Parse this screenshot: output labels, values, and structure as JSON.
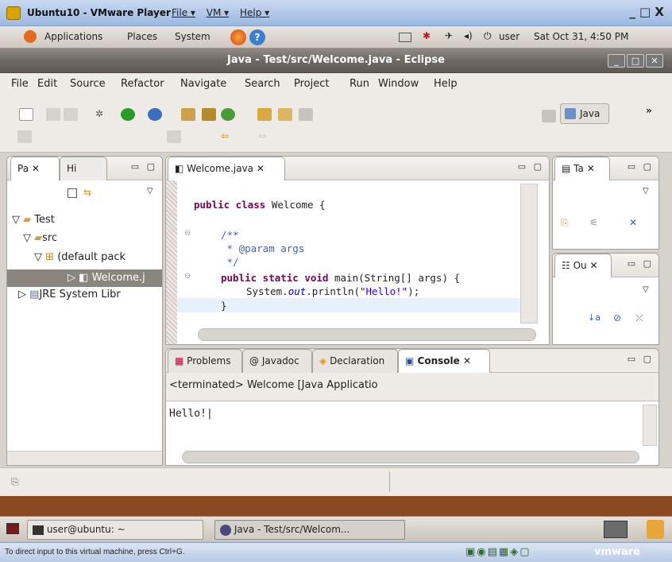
{
  "vmware": {
    "title": "Ubuntu10 - VMware Player",
    "menus": [
      "File ▾",
      "VM ▾",
      "Help ▾"
    ],
    "controls": "_ □ X"
  },
  "gnome": {
    "applications": "Applications",
    "places": "Places",
    "system": "System",
    "user": "user",
    "datetime": "Sat Oct 31, 4:50 PM"
  },
  "eclipse": {
    "title": "Java - Test/src/Welcome.java - Eclipse",
    "menu": [
      "File",
      "Edit",
      "Source",
      "Refactor",
      "Navigate",
      "Search",
      "Project",
      "Run",
      "Window",
      "Help"
    ],
    "perspective": "Java",
    "package_explorer": {
      "tab1": "Pa",
      "tab2": "Hi",
      "tree": [
        "Test",
        "src",
        "(default pack",
        "Welcome.j",
        "JRE System Libr"
      ]
    },
    "editor": {
      "tab": "Welcome.java",
      "lines": {
        "l1_kw": "public class",
        "l1_rest": " Welcome {",
        "l2": "/**",
        "l3": " * @param args",
        "l4": " */",
        "l5_kw": "public static void",
        "l5_rest": " main(String[] args) {",
        "l6_a": "System.",
        "l6_out": "out",
        "l6_b": ".println(",
        "l6_str": "\"Hello!\"",
        "l6_c": ");",
        "l7": "}"
      }
    },
    "right": {
      "tasks_tab": "Ta",
      "outline_tab": "Ou"
    },
    "bottom": {
      "tabs": [
        "Problems",
        "Javadoc",
        "Declaration",
        "Console"
      ],
      "console_header": "<terminated> Welcome [Java Applicatio",
      "console_output": "Hello!"
    }
  },
  "taskbar": {
    "item1": "user@ubuntu: ~",
    "item2": "Java - Test/src/Welcom..."
  },
  "status": {
    "hint": "To direct input to this virtual machine, press Ctrl+G.",
    "brand": "vmware"
  }
}
